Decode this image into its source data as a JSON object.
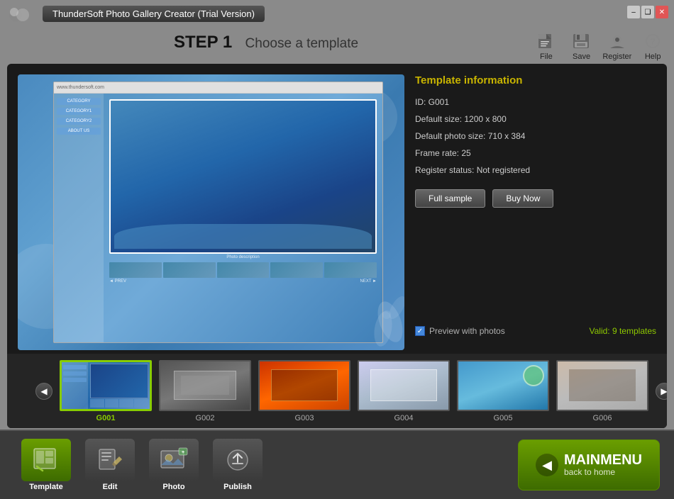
{
  "window": {
    "title": "ThunderSoft Photo Gallery Creator (Trial Version)"
  },
  "controls": {
    "minimize": "–",
    "restore": "❑",
    "close": "✕"
  },
  "toolbar": {
    "file_label": "File",
    "save_label": "Save",
    "register_label": "Register",
    "help_label": "Help"
  },
  "step_header": {
    "step": "STEP 1",
    "text": "Choose a template"
  },
  "template_info": {
    "title": "Template information",
    "id_label": "ID: G001",
    "default_size_label": "Default size: 1200 x 800",
    "photo_size_label": "Default photo size: 710 x 384",
    "frame_rate_label": "Frame rate: 25",
    "register_label": "Register status: Not registered",
    "btn_full_sample": "Full sample",
    "btn_buy_now": "Buy Now",
    "preview_check_label": "Preview with photos",
    "valid_label": "Valid: 9 templates"
  },
  "thumbnail_strip": {
    "prev_arrow": "◀",
    "next_arrow": "▶",
    "thumbnails": [
      {
        "id": "G001",
        "active": true
      },
      {
        "id": "G002",
        "active": false
      },
      {
        "id": "G003",
        "active": false
      },
      {
        "id": "G004",
        "active": false
      },
      {
        "id": "G005",
        "active": false
      },
      {
        "id": "G006",
        "active": false
      }
    ]
  },
  "bottom_nav": {
    "items": [
      {
        "id": "template",
        "label": "Template",
        "active": true,
        "icon": "📋"
      },
      {
        "id": "edit",
        "label": "Edit",
        "active": false,
        "icon": "✏️"
      },
      {
        "id": "photo",
        "label": "Photo",
        "active": false,
        "icon": "🖼️"
      },
      {
        "id": "publish",
        "label": "Publish",
        "active": false,
        "icon": "📤"
      }
    ],
    "mainmenu": {
      "label": "MAINMENU",
      "sublabel": "back to home",
      "arrow": "◀"
    }
  },
  "preview": {
    "sidebar_items": [
      "CATEGORY",
      "CATEGORY1",
      "CATEGORY2",
      "ABOUT US"
    ],
    "photo_caption": "Photo description",
    "nav_prev": "◄ PREV",
    "nav_next": "NEXT ►",
    "top_url": "www.thundersoft.com"
  }
}
